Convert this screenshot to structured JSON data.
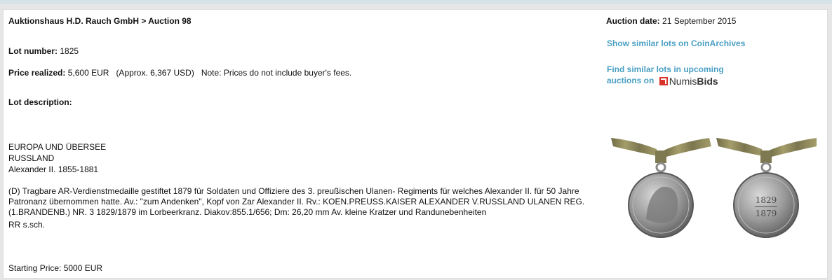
{
  "header": {
    "breadcrumb": "Auktionshaus H.D. Rauch GmbH > Auction 98",
    "auction_date_label": "Auction date:",
    "auction_date_value": "21 September 2015"
  },
  "lot": {
    "number_label": "Lot number:",
    "number_value": "1825",
    "price_label": "Price realized:",
    "price_value": "5,600 EUR",
    "price_approx": "(Approx. 6,367 USD)",
    "price_note": "Note: Prices do not include buyer's fees.",
    "description_label": "Lot description:",
    "region_lines": [
      "EUROPA UND ÜBERSEE",
      "RUSSLAND",
      "Alexander II. 1855-1881"
    ],
    "description": "(D) Tragbare AR-Verdienstmedaille gestiftet 1879 für Soldaten und Offiziere des 3. preußischen Ulanen- Regiments für welches Alexander II. für 50 Jahre Patronanz übernommen hatte. Av.: \"zum Andenken\", Kopf von Zar Alexander II. Rv.: KOEN.PREUSS.KAISER ALEXANDER V.RUSSLAND ULANEN REG.(1.BRANDENB.) NR. 3 1829/1879 im Lorbeerkranz. Diakov:855.1/656; Dm: 26,20 mm Av. kleine Kratzer und Randunebenheiten",
    "rarity": "RR s.sch.",
    "starting_price": "Starting Price: 5000 EUR"
  },
  "sidebar": {
    "similar_link": "Show similar lots on CoinArchives",
    "find_link_line1": "Find similar lots in upcoming",
    "find_link_line2": "auctions on",
    "numisbids_light": "Numis",
    "numisbids_bold": "Bids",
    "medal_reverse_year1": "1829",
    "medal_reverse_year2": "1879"
  },
  "colors": {
    "link": "#4a9fc4",
    "logo_red": "#d9322b",
    "ribbon": "#8b8558",
    "silver": "#9a9a9a"
  }
}
